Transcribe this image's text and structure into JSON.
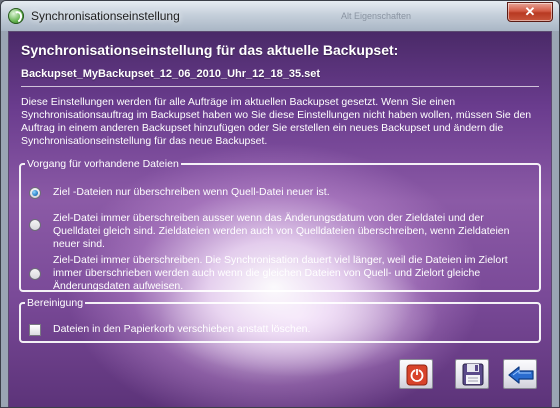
{
  "window": {
    "title": "Synchronisationseinstellung",
    "background_ghost_text": "Alt Eigenschaften",
    "close_symbol": "✕"
  },
  "dialog": {
    "heading": "Synchronisationseinstellung für das aktuelle Backupset:",
    "backupset_name": "Backupset_MyBackupset_12_06_2010_Uhr_12_18_35.set",
    "description": "Diese Einstellungen werden für alle Aufträge im aktuellen Backupset gesetzt. Wenn Sie einen Synchronisationsauftrag im Backupset haben wo Sie diese Einstellungen nicht haben wollen, müssen Sie den Auftrag in einem anderen Backupset hinzufügen oder Sie erstellen ein neues Backupset und ändern die Synchronisationseinstellung für das neue Backupset.",
    "existing_files_group": {
      "legend": "Vorgang für vorhandene Dateien",
      "options": [
        {
          "label": "Ziel -Dateien nur überschreiben wenn Quell-Datei neuer ist.",
          "selected": true
        },
        {
          "label": "Ziel-Datei immer überschreiben ausser wenn das Änderungsdatum von der Zieldatei und der Quelldatei gleich sind. Zieldateien werden auch von Quelldateien überschreiben, wenn Zieldateien neuer sind.",
          "selected": false
        },
        {
          "label": "Ziel-Datei immer überschreiben. Die Synchronisation dauert viel länger, weil die Dateien im Zielort immer überschrieben werden auch wenn die gleichen Dateien von Quell- und Zielort gleiche Änderungsdaten aufweisen.",
          "selected": false
        }
      ]
    },
    "cleanup_group": {
      "legend": "Bereinigung",
      "checkbox_label": "Dateien in den Papierkorb verschieben anstatt löschen.",
      "checked": false
    },
    "buttons": [
      {
        "icon": "power-icon"
      },
      {
        "icon": "floppy-disk-icon"
      },
      {
        "icon": "back-arrow-icon"
      }
    ]
  },
  "colors": {
    "accent_red": "#d8432b",
    "radio_blue": "#1f78c1",
    "arrow_blue": "#2a6ccf"
  }
}
